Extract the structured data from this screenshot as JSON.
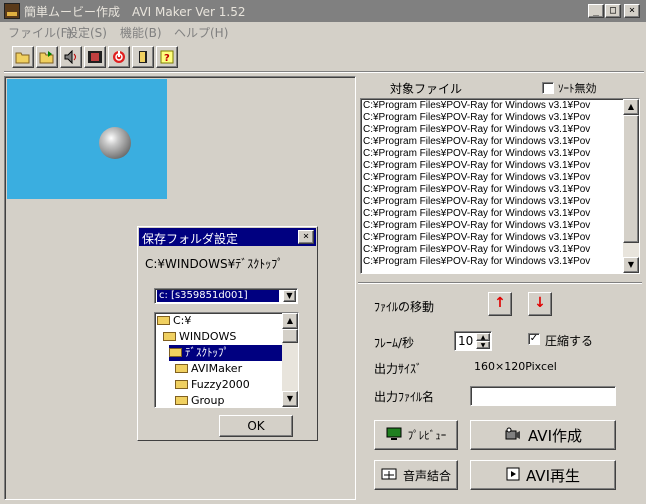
{
  "window": {
    "title": "簡単ムービー作成　AVI Maker Ver 1.52",
    "minimize": "_",
    "maximize": "□",
    "close": "×"
  },
  "menu": [
    "ファイル(F)",
    "設定(S)",
    "機能(B)",
    "ヘルプ(H)"
  ],
  "toolbar": {
    "icons": [
      "open-folder-icon",
      "open-folder-icon",
      "sound-icon",
      "film-icon",
      "power-icon",
      "exit-door-icon",
      "help-icon"
    ]
  },
  "dialog": {
    "title": "保存フォルダ設定",
    "close": "×",
    "path": "C:¥WINDOWS¥ﾃﾞｽｸﾄｯﾌﾟ",
    "drive": "c: [s359851d001]",
    "folders": [
      {
        "name": "C:¥",
        "indent": 0,
        "selected": false
      },
      {
        "name": "WINDOWS",
        "indent": 1,
        "selected": false
      },
      {
        "name": "ﾃﾞｽｸﾄｯﾌﾟ",
        "indent": 2,
        "selected": true
      },
      {
        "name": "AVIMaker",
        "indent": 3,
        "selected": false
      },
      {
        "name": "Fuzzy2000",
        "indent": 3,
        "selected": false
      },
      {
        "name": "Group",
        "indent": 3,
        "selected": false
      }
    ],
    "ok_label": "OK"
  },
  "files": {
    "header": "対象ファイル",
    "sort_label": "ｿｰﾄ無効",
    "sort_disabled": false,
    "items": [
      "C:¥Program Files¥POV-Ray for Windows v3.1¥Pov",
      "C:¥Program Files¥POV-Ray for Windows v3.1¥Pov",
      "C:¥Program Files¥POV-Ray for Windows v3.1¥Pov",
      "C:¥Program Files¥POV-Ray for Windows v3.1¥Pov",
      "C:¥Program Files¥POV-Ray for Windows v3.1¥Pov",
      "C:¥Program Files¥POV-Ray for Windows v3.1¥Pov",
      "C:¥Program Files¥POV-Ray for Windows v3.1¥Pov",
      "C:¥Program Files¥POV-Ray for Windows v3.1¥Pov",
      "C:¥Program Files¥POV-Ray for Windows v3.1¥Pov",
      "C:¥Program Files¥POV-Ray for Windows v3.1¥Pov",
      "C:¥Program Files¥POV-Ray for Windows v3.1¥Pov",
      "C:¥Program Files¥POV-Ray for Windows v3.1¥Pov",
      "C:¥Program Files¥POV-Ray for Windows v3.1¥Pov",
      "C:¥Program Files¥POV-Ray for Windows v3.1¥Pov"
    ]
  },
  "controls": {
    "move_label": "ﾌｧｲﾙの移動",
    "up_arrow": "↑",
    "down_arrow": "↓",
    "fps_label": "ﾌﾚｰﾑ/秒",
    "fps_value": "10",
    "compress_label": "圧縮する",
    "compress_checked": true,
    "output_size_label": "出力ｻｲｽﾞ",
    "output_size_value": "160×120Pixcel",
    "output_name_label": "出力ﾌｧｲﾙ名",
    "output_name_value": "",
    "preview_label": "ﾌﾟﾚﾋﾞｭｰ",
    "avi_create_label": "AVI作成",
    "audio_merge_label": "音声結合",
    "avi_play_label": "AVI再生"
  }
}
